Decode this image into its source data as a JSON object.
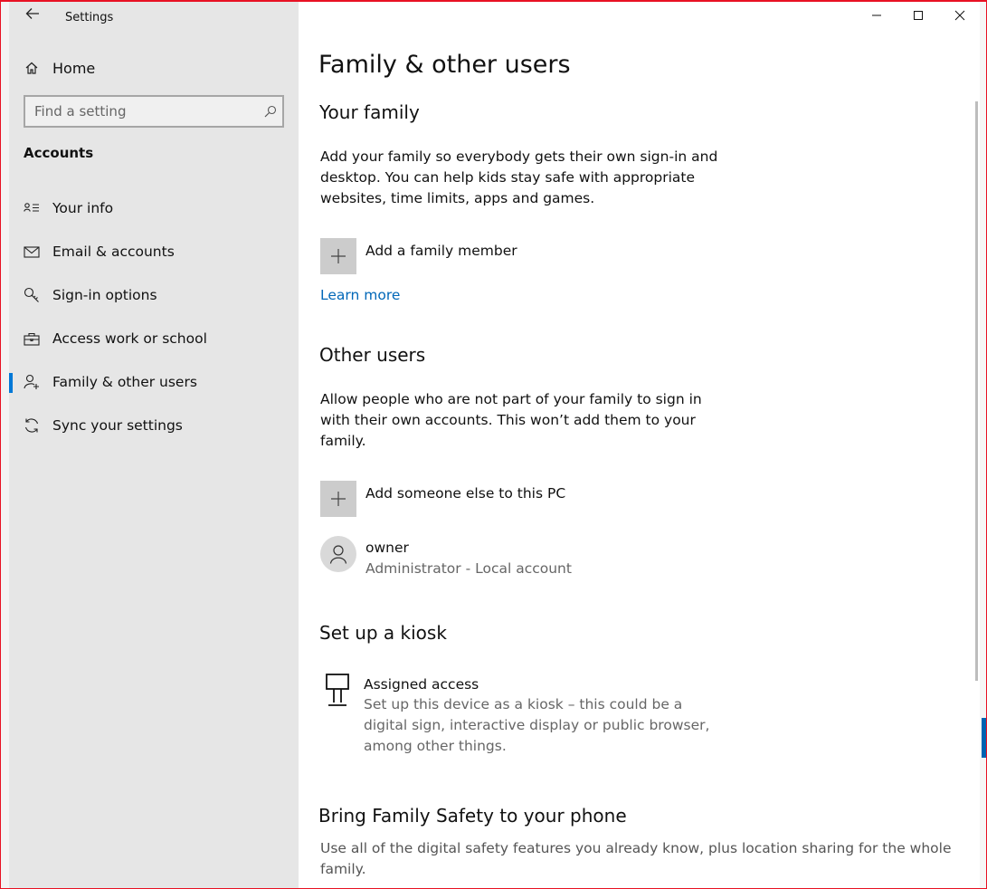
{
  "window": {
    "title": "Settings",
    "controls": {
      "minimize": "minimize",
      "maximize": "maximize",
      "close": "close"
    }
  },
  "sidebar": {
    "home_label": "Home",
    "search": {
      "placeholder": "Find a setting"
    },
    "section_title": "Accounts",
    "items": [
      {
        "label": "Your info",
        "icon": "contact-card-icon",
        "active": false
      },
      {
        "label": "Email & accounts",
        "icon": "mail-icon",
        "active": false
      },
      {
        "label": "Sign-in options",
        "icon": "key-icon",
        "active": false
      },
      {
        "label": "Access work or school",
        "icon": "briefcase-icon",
        "active": false
      },
      {
        "label": "Family & other users",
        "icon": "add-person-icon",
        "active": true
      },
      {
        "label": "Sync your settings",
        "icon": "sync-icon",
        "active": false
      }
    ]
  },
  "main": {
    "page_title": "Family & other users",
    "your_family": {
      "heading": "Your family",
      "description": "Add your family so everybody gets their own sign-in and desktop. You can help kids stay safe with appropriate websites, time limits, apps and games.",
      "add_label": "Add a family member",
      "learn_more": "Learn more"
    },
    "other_users": {
      "heading": "Other users",
      "description": "Allow people who are not part of your family to sign in with their own accounts. This won’t add them to your family.",
      "add_label": "Add someone else to this PC",
      "user": {
        "name": "owner",
        "detail": "Administrator - Local account"
      }
    },
    "kiosk": {
      "heading": "Set up a kiosk",
      "name": "Assigned access",
      "description": "Set up this device as a kiosk – this could be a digital sign, interactive display or public browser, among other things."
    },
    "family_safety": {
      "heading": "Bring Family Safety to your phone",
      "description": "Use all of the digital safety features you already know, plus location sharing for the whole family."
    }
  },
  "colors": {
    "accent": "#0078d7",
    "link": "#0067b8",
    "sidebar_bg": "#e6e6e6",
    "tile_bg": "#cccccc",
    "border": "#e81123"
  }
}
